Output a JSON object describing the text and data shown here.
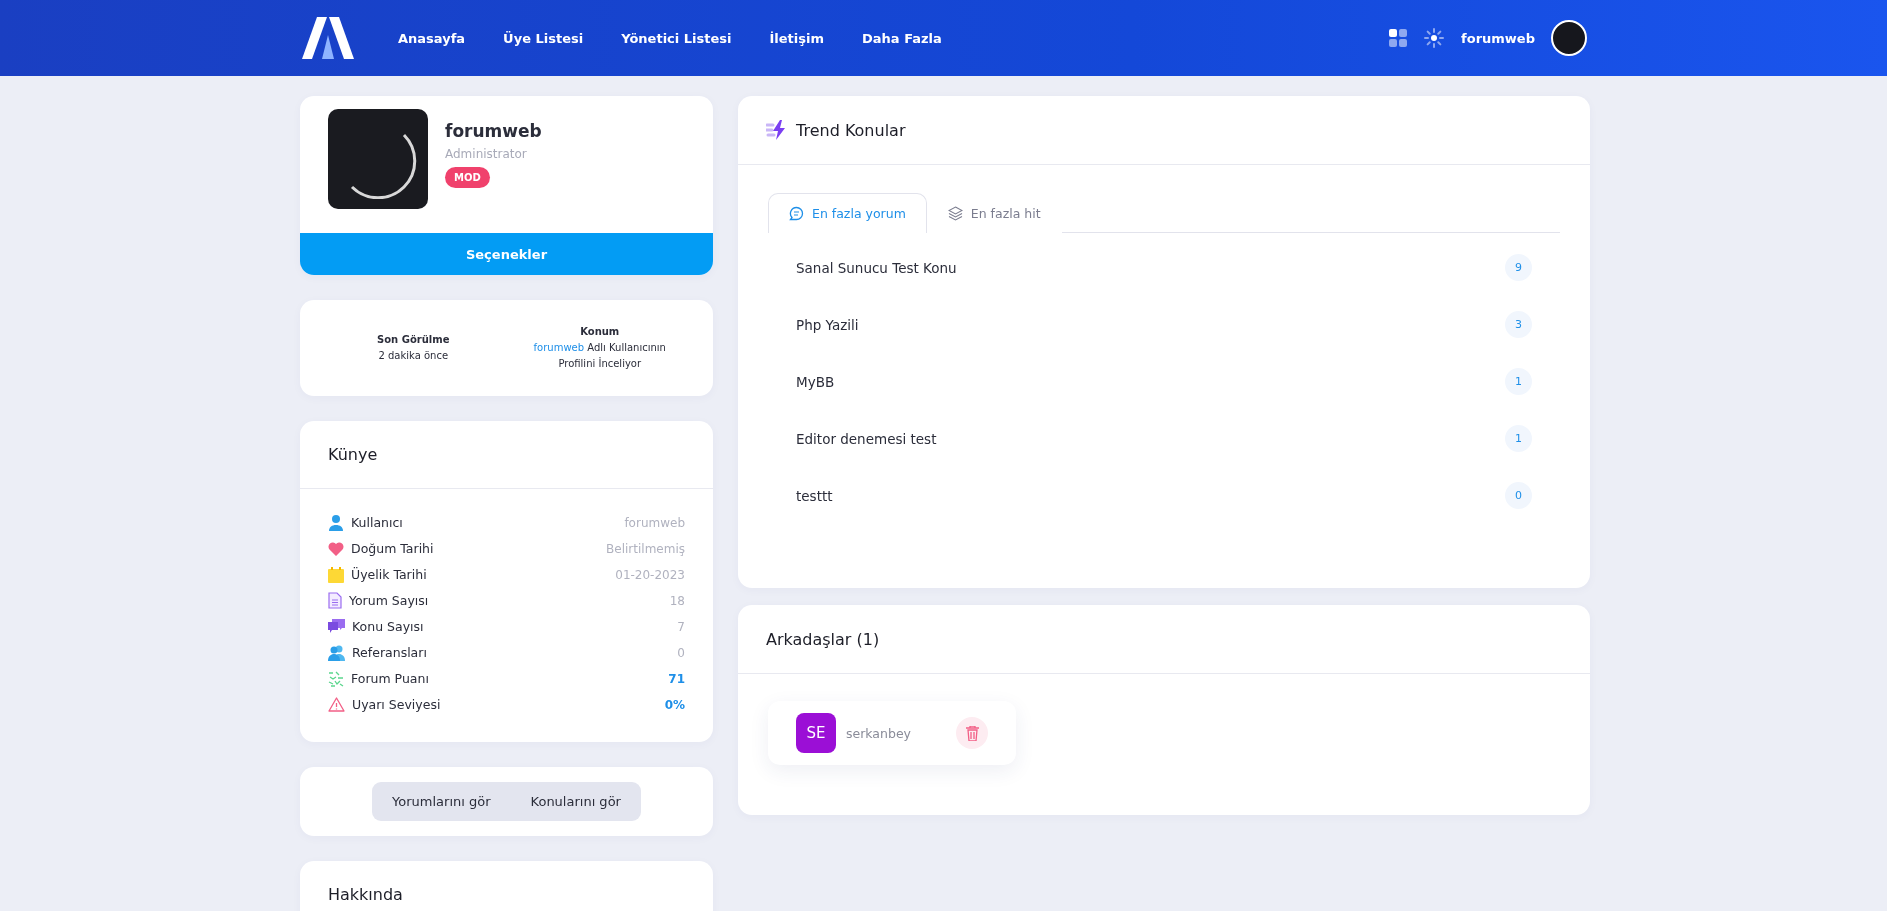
{
  "nav": {
    "links": [
      "Anasayfa",
      "Üye Listesi",
      "Yönetici Listesi",
      "İletişim",
      "Daha Fazla"
    ],
    "username": "forumweb"
  },
  "profile": {
    "name": "forumweb",
    "role": "Administrator",
    "badge": "MOD",
    "options_button": "Seçenekler"
  },
  "status": {
    "last_seen_label": "Son Görülme",
    "last_seen": "2 dakika önce",
    "location_label": "Konum",
    "location_link": "forumweb",
    "location_text": "Adlı Kullanıcının Profilini İnceliyor"
  },
  "kunye": {
    "title": "Künye",
    "rows": [
      {
        "label": "Kullanıcı",
        "value": "forumweb",
        "highlight": false
      },
      {
        "label": "Doğum Tarihi",
        "value": "Belirtilmemiş",
        "highlight": false
      },
      {
        "label": "Üyelik Tarihi",
        "value": "01-20-2023",
        "highlight": false
      },
      {
        "label": "Yorum Sayısı",
        "value": "18",
        "highlight": false
      },
      {
        "label": "Konu Sayısı",
        "value": "7",
        "highlight": false
      },
      {
        "label": "Referansları",
        "value": "0",
        "highlight": false
      },
      {
        "label": "Forum Puanı",
        "value": "71",
        "highlight": true
      },
      {
        "label": "Uyarı Seviyesi",
        "value": "0%",
        "highlight": true
      }
    ]
  },
  "view_buttons": [
    "Yorumlarını gör",
    "Konularını gör"
  ],
  "about": {
    "title": "Hakkında"
  },
  "trend": {
    "title": "Trend Konular",
    "tabs": [
      {
        "label": "En fazla yorum",
        "selected": true
      },
      {
        "label": "En fazla hit",
        "selected": false
      }
    ],
    "topics": [
      {
        "title": "Sanal Sunucu Test Konu",
        "count": "9"
      },
      {
        "title": "Php Yazili",
        "count": "3"
      },
      {
        "title": "MyBB",
        "count": "1"
      },
      {
        "title": "Editor denemesi test",
        "count": "1"
      },
      {
        "title": "testtt",
        "count": "0"
      }
    ]
  },
  "friends": {
    "title": "Arkadaşlar (1)",
    "items": [
      {
        "initials": "SE",
        "name": "serkanbey"
      }
    ]
  }
}
